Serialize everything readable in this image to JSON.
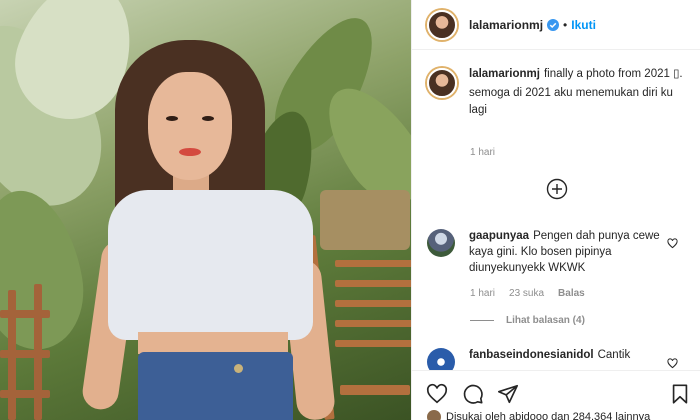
{
  "post": {
    "image_alt": "Woman in white crop top and jeans in front of tropical plants",
    "author": {
      "username": "lalamarionmj",
      "verified": true
    },
    "header": {
      "separator": "•",
      "follow_label": "Ikuti"
    },
    "caption": {
      "username": "lalamarionmj",
      "line1": "finally a photo from 2021 ▯.",
      "line2": "semoga di 2021 aku menemukan diri ku lagi",
      "time": "1 hari"
    },
    "load_more_icon": "plus-circle-icon"
  },
  "comments": [
    {
      "username": "gaapunyaa",
      "text": "Pengen dah punya cewe kaya gini. Klo bosen pipinya diunyekunyekk WKWK",
      "time": "1 hari",
      "likes": "23 suka",
      "reply_label": "Balas",
      "view_replies": "Lihat balasan (4)"
    },
    {
      "username": "fanbaseindonesianidol",
      "text": "Cantik"
    }
  ],
  "actions": {
    "icons": [
      "heart-icon",
      "comment-icon",
      "share-icon",
      "bookmark-icon"
    ],
    "liked_by_text": "Disukai oleh abidooo dan 284.364 lainnya"
  },
  "colors": {
    "accent": "#0095f6",
    "text": "#262626",
    "muted": "#8e8e8e",
    "divider": "#efefef"
  }
}
